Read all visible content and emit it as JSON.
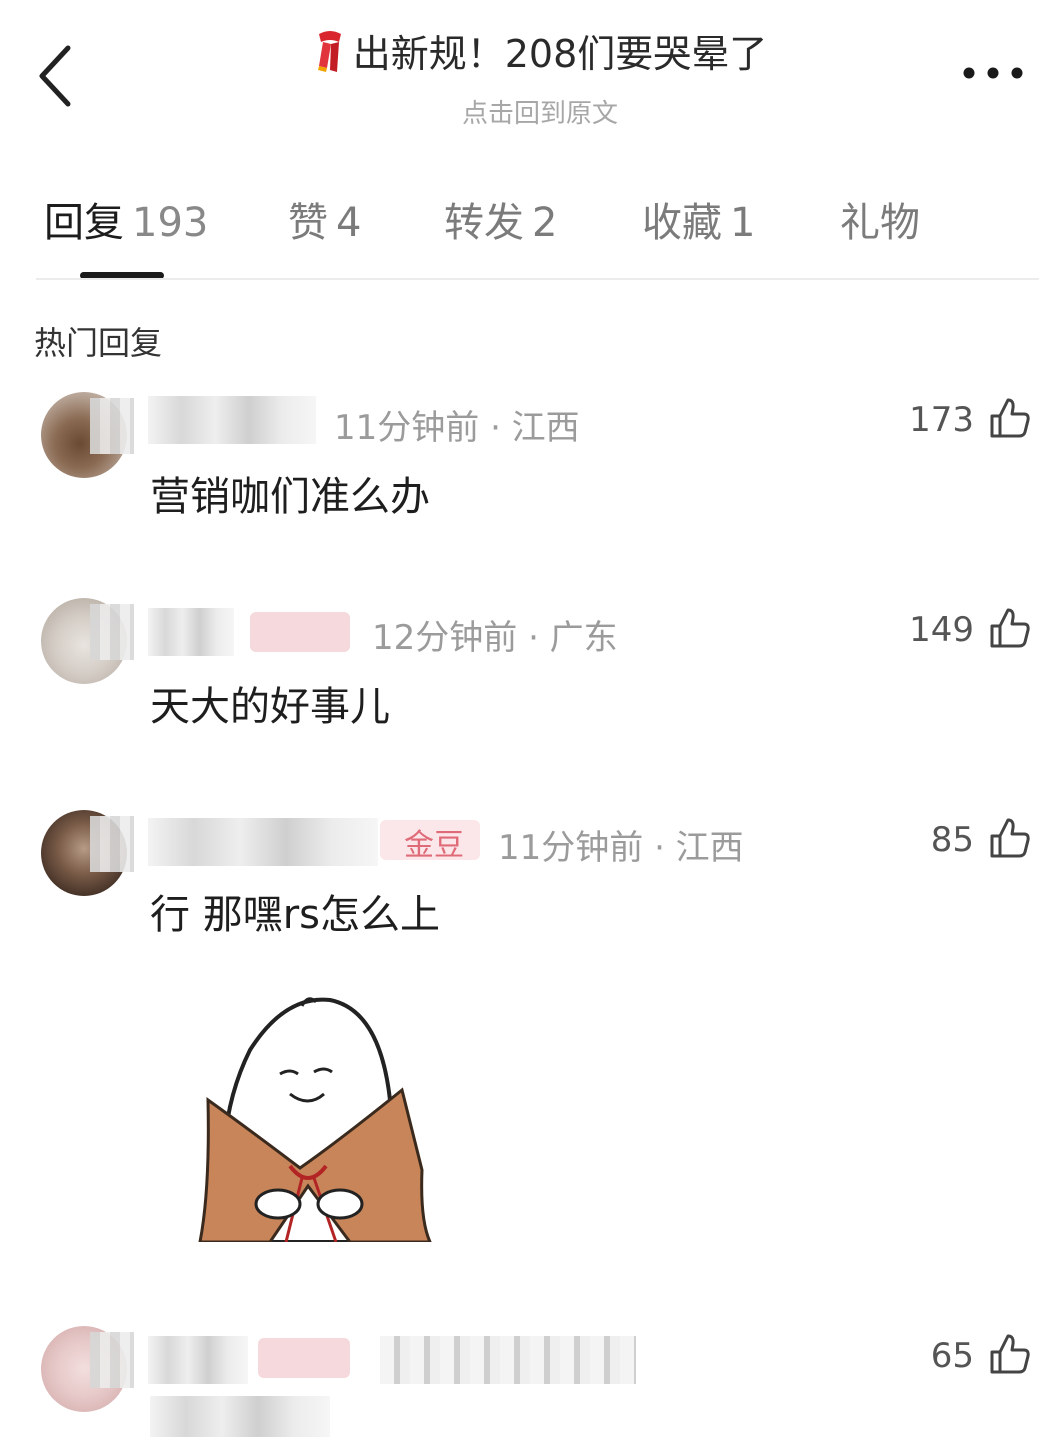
{
  "header": {
    "title": "出新规！208们要哭晕了",
    "subtitle": "点击回到原文",
    "back_icon": "chevron-left-icon",
    "more_icon": "more-horizontal-icon",
    "title_icon": "red-scarf-emoji"
  },
  "tabs": [
    {
      "label": "回复",
      "count": "193"
    },
    {
      "label": "赞",
      "count": "4"
    },
    {
      "label": "转发",
      "count": "2"
    },
    {
      "label": "收藏",
      "count": "1"
    },
    {
      "label": "礼物",
      "count": ""
    }
  ],
  "section_title": "热门回复",
  "comments": [
    {
      "time_location": "11分钟前 · 江西",
      "likes": "173",
      "text": "营销咖们准么办"
    },
    {
      "time_location": "12分钟前 · 广东",
      "likes": "149",
      "text": "天大的好事儿"
    },
    {
      "badge": "金豆",
      "time_location": "11分钟前 · 江西",
      "likes": "85",
      "text": "行 那嘿rs怎么上",
      "has_sticker": true
    },
    {
      "likes": "65"
    }
  ],
  "colors": {
    "accent_underline": "#1a1a1a",
    "meta_gray": "#9b9b9b",
    "badge_pink": "#e06b78"
  }
}
